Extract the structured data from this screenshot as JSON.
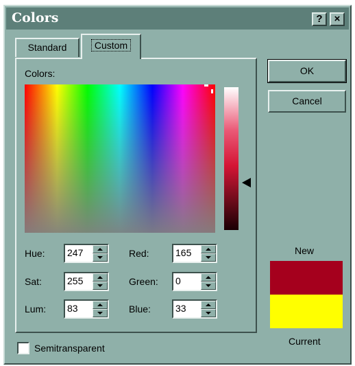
{
  "window": {
    "title": "Colors",
    "help_button": "?",
    "close_button": "×"
  },
  "tabs": [
    {
      "label": "Standard",
      "selected": false
    },
    {
      "label": "Custom",
      "selected": true
    }
  ],
  "colors_label": "Colors:",
  "fields": {
    "hue": {
      "label": "Hue:",
      "value": "247"
    },
    "sat": {
      "label": "Sat:",
      "value": "255"
    },
    "lum": {
      "label": "Lum:",
      "value": "83"
    },
    "red": {
      "label": "Red:",
      "value": "165"
    },
    "green": {
      "label": "Green:",
      "value": "0"
    },
    "blue": {
      "label": "Blue:",
      "value": "33"
    }
  },
  "buttons": {
    "ok": "OK",
    "cancel": "Cancel"
  },
  "preview": {
    "new_label": "New",
    "current_label": "Current",
    "new_color": "#a5001d",
    "current_color": "#ffff00"
  },
  "semitransparent": {
    "label": "Semitransparent",
    "checked": false
  },
  "colors": {
    "dialog_bg": "#8fb0a9",
    "titlebar_bg": "#5d7f79"
  }
}
